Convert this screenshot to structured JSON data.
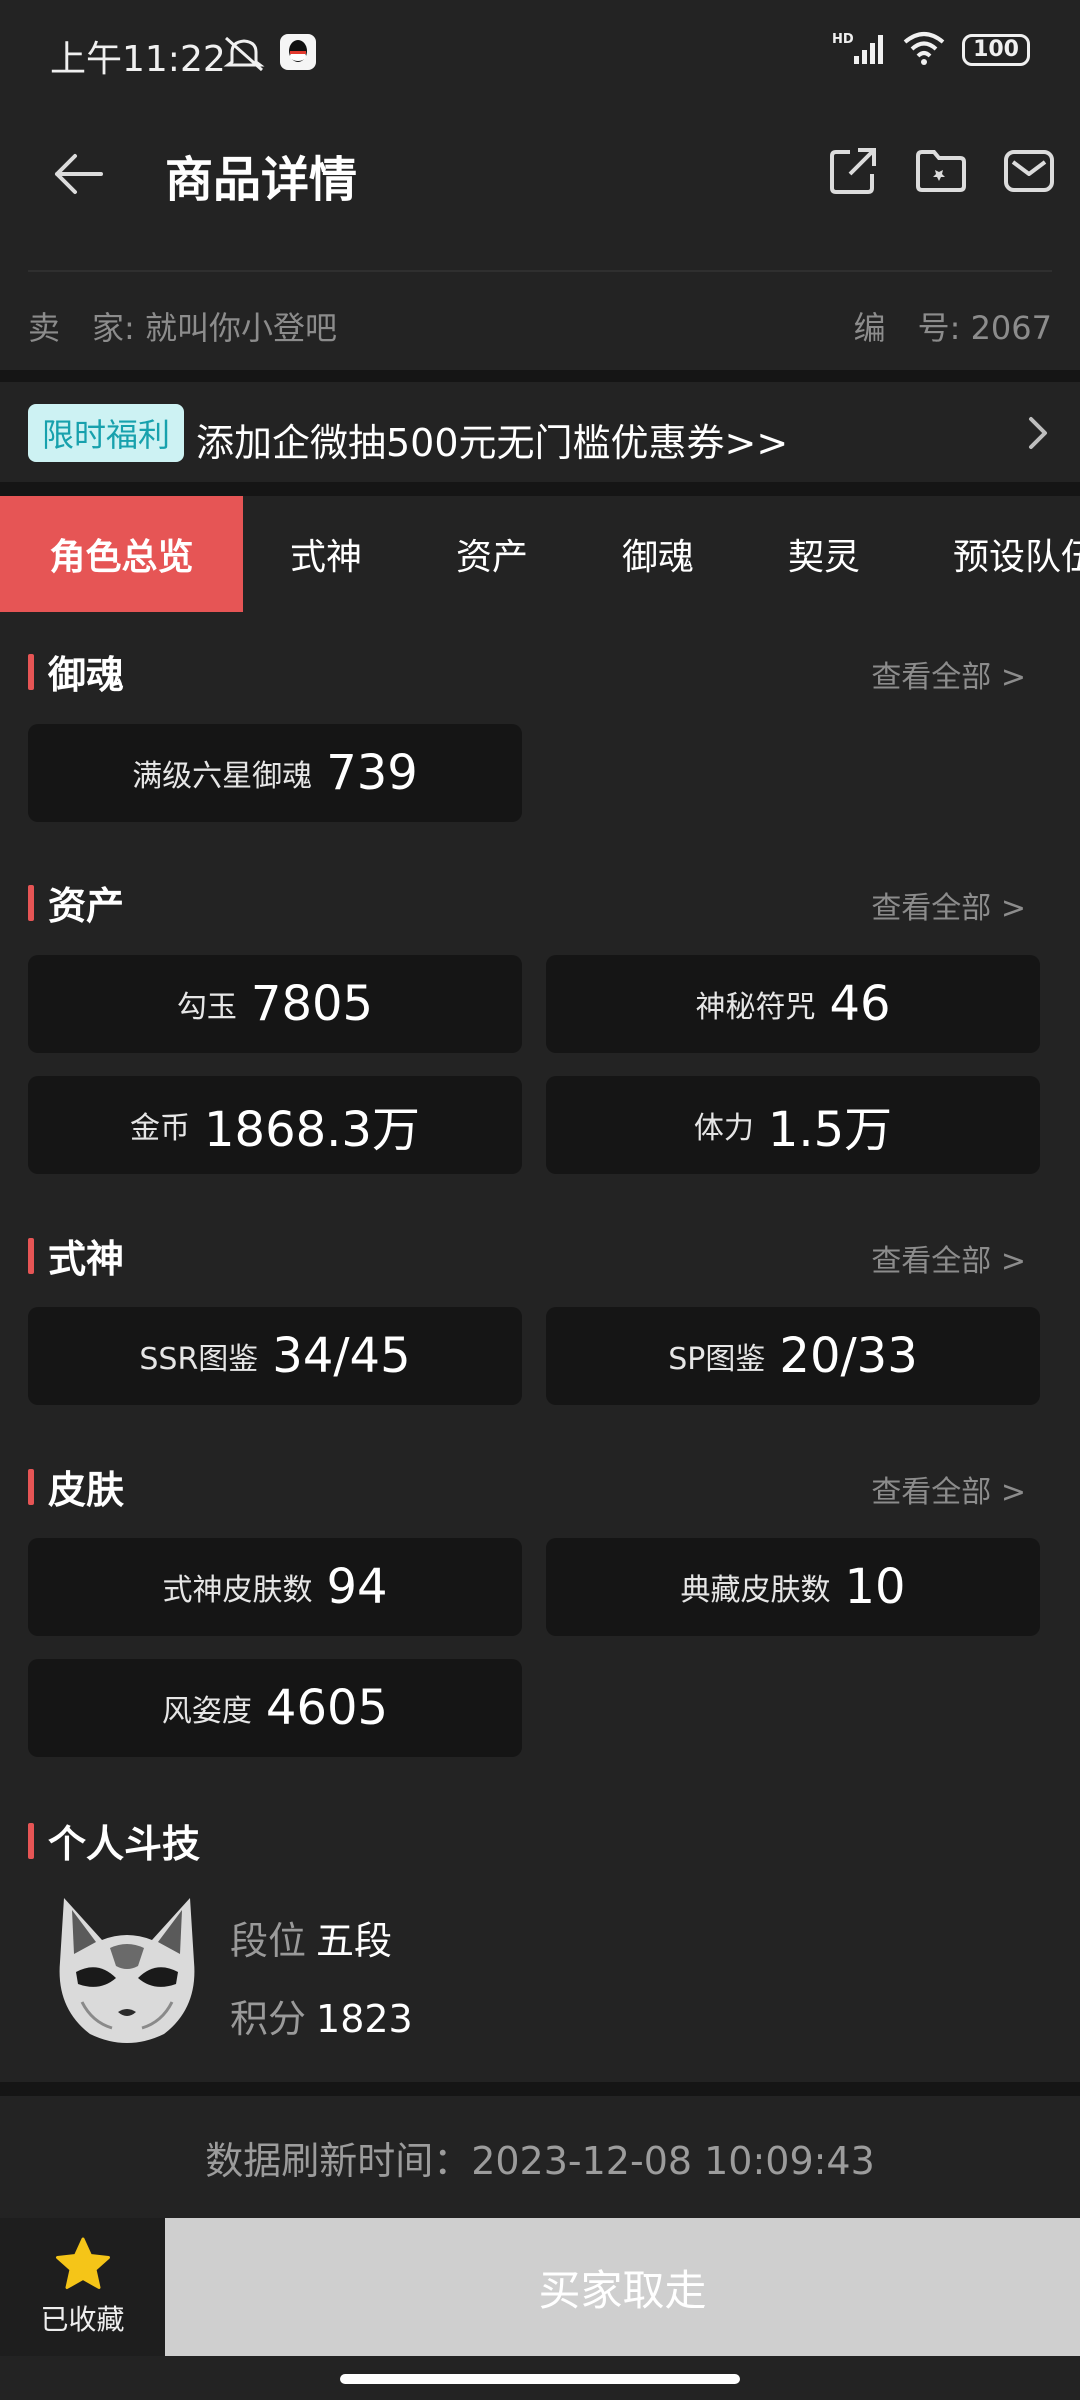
{
  "status_bar": {
    "time": "上午11:22",
    "network": "HD",
    "battery": "100",
    "icons": [
      "mute-icon",
      "qq-icon",
      "signal-icon",
      "wifi-icon",
      "battery-icon"
    ]
  },
  "header": {
    "title": "商品详情",
    "icons": [
      "share-icon",
      "folder-icon",
      "message-icon"
    ]
  },
  "seller": {
    "seller_label": "卖　家:",
    "seller_name": "就叫你小登吧",
    "id_label": "编　号:",
    "id_value": "2067"
  },
  "promo": {
    "badge": "限时福利",
    "text": "添加企微抽500元无门槛优惠券>>"
  },
  "tabs": [
    "角色总览",
    "式神",
    "资产",
    "御魂",
    "契灵",
    "预设队伍"
  ],
  "sections": {
    "yuhun": {
      "title": "御魂",
      "view_all": "查看全部 >",
      "cards": [
        {
          "label": "满级六星御魂",
          "value": "739"
        }
      ]
    },
    "assets": {
      "title": "资产",
      "view_all": "查看全部 >",
      "cards": [
        {
          "label": "勾玉",
          "value": "7805"
        },
        {
          "label": "神秘符咒",
          "value": "46"
        },
        {
          "label": "金币",
          "value": "1868.3万"
        },
        {
          "label": "体力",
          "value": "1.5万"
        }
      ]
    },
    "shikigami": {
      "title": "式神",
      "view_all": "查看全部 >",
      "cards": [
        {
          "label": "SSR图鉴",
          "value": "34/45"
        },
        {
          "label": "SP图鉴",
          "value": "20/33"
        }
      ]
    },
    "skins": {
      "title": "皮肤",
      "view_all": "查看全部 >",
      "cards": [
        {
          "label": "式神皮肤数",
          "value": "94"
        },
        {
          "label": "典藏皮肤数",
          "value": "10"
        },
        {
          "label": "风姿度",
          "value": "4605"
        }
      ]
    },
    "pvp": {
      "title": "个人斗技",
      "rank_label": "段位",
      "rank_value": "五段",
      "score_label": "积分",
      "score_value": "1823"
    }
  },
  "refresh_time": "数据刷新时间：2023-12-08 10:09:43",
  "bottom": {
    "favorite_label": "已收藏",
    "buy_label": "买家取走"
  },
  "colors": {
    "background": "#232323",
    "accent": "#e65555",
    "card": "#151515",
    "promo_badge_bg": "#cdf2f3",
    "promo_badge_text": "#17a1ad",
    "star": "#f5c518"
  }
}
